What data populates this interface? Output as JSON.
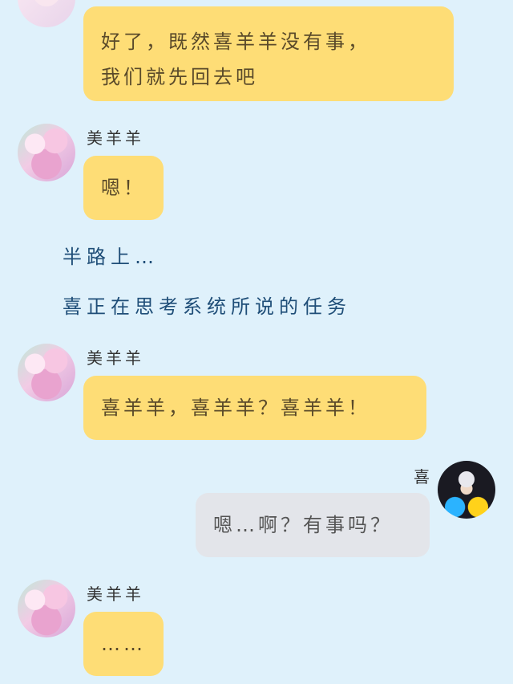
{
  "messages": [
    {
      "speaker": "",
      "text_lines": [
        "好了，既然喜羊羊没有事，",
        "我们就先回去吧"
      ]
    },
    {
      "speaker": "美羊羊",
      "text": "嗯！"
    },
    {
      "speaker": "美羊羊",
      "text": "喜羊羊，喜羊羊？喜羊羊！"
    },
    {
      "speaker": "喜",
      "text": "嗯…啊？有事吗？"
    },
    {
      "speaker": "美羊羊",
      "text": "……"
    }
  ],
  "narration": [
    "半路上…",
    "喜正在思考系统所说的任务"
  ],
  "colors": {
    "background": "#dff1fb",
    "bubble_yellow": "#fedd76",
    "bubble_gray": "#e3e5ea",
    "narration_text": "#1f4e78"
  },
  "avatars": {
    "mei": "pink-haired-girl-avatar",
    "xi": "dark-background-boy-avatar"
  }
}
